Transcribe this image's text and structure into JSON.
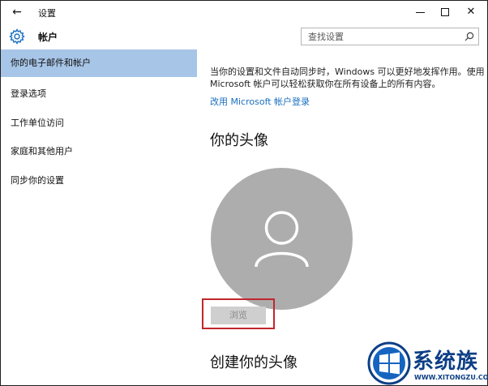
{
  "window": {
    "title": "设置",
    "back_glyph": "←",
    "close_glyph": "✕"
  },
  "header": {
    "section_title": "帐户",
    "search_placeholder": "查找设置"
  },
  "sidebar": {
    "items": [
      {
        "label": "你的电子邮件和帐户",
        "active": true
      },
      {
        "label": "登录选项",
        "active": false
      },
      {
        "label": "工作单位访问",
        "active": false
      },
      {
        "label": "家庭和其他用户",
        "active": false
      },
      {
        "label": "同步你的设置",
        "active": false
      }
    ]
  },
  "main": {
    "description": "当你的设置和文件自动同步时，Windows 可以更好地发挥作用。使用 Microsoft 帐户可以轻松获取你在所有设备上的所有内容。",
    "change_link": "改用 Microsoft 帐户登录",
    "avatar_heading": "你的头像",
    "browse_label": "浏览",
    "create_heading": "创建你的头像"
  },
  "watermark": {
    "brand": "系统族",
    "url": "WWW.XITONGZU.COM"
  },
  "colors": {
    "active_nav": "#a7c5e7",
    "link": "#1a6fc1",
    "avatar_bg": "#adadad",
    "highlight": "#c0262c",
    "watermark": "#0d3f86"
  }
}
